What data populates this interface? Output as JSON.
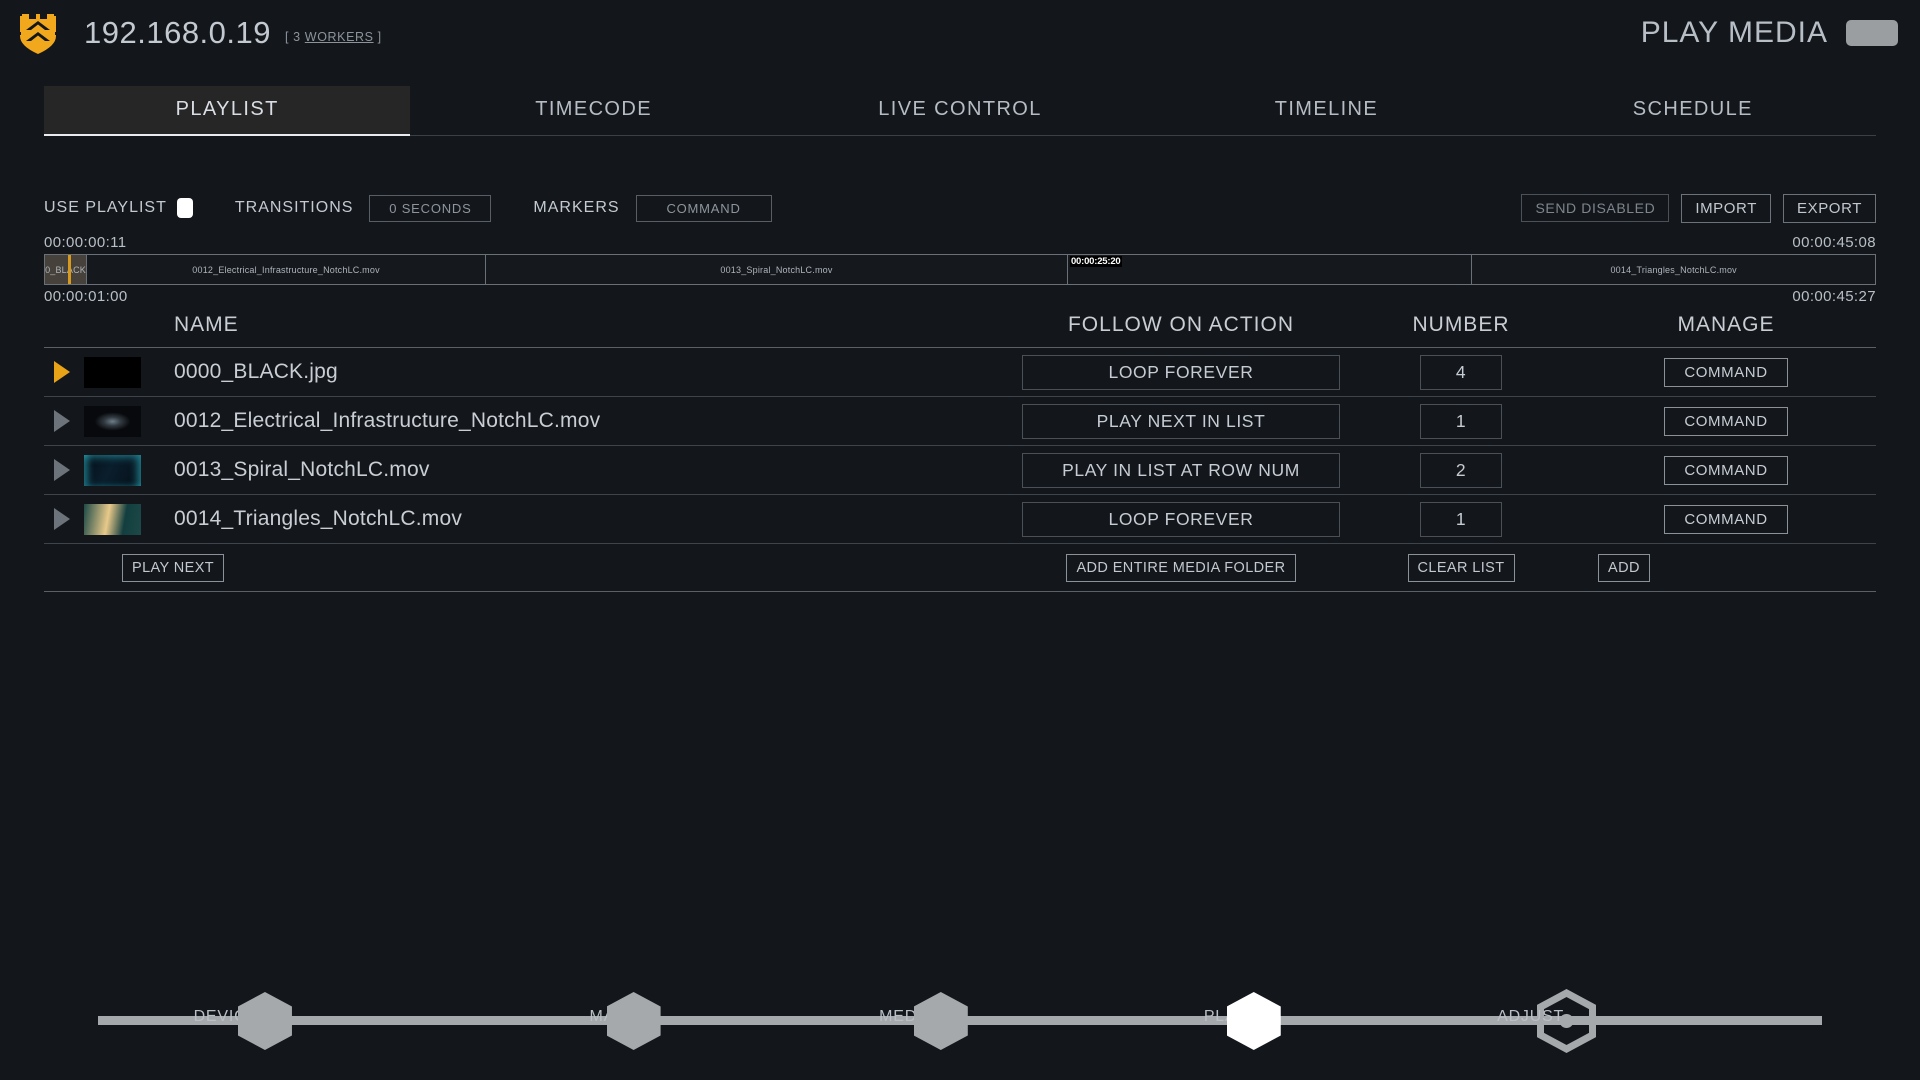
{
  "header": {
    "logo_icon": "shield-chevron-logo-icon",
    "host": "192.168.0.19",
    "workers_prefix": "[ 3 ",
    "workers_link": "WORKERS",
    "workers_suffix": " ]",
    "mode_title": "PLAY MEDIA",
    "accent_color": "#f2a81d"
  },
  "tabs": [
    {
      "label": "PLAYLIST",
      "active": true
    },
    {
      "label": "TIMECODE",
      "active": false
    },
    {
      "label": "LIVE CONTROL",
      "active": false
    },
    {
      "label": "TIMELINE",
      "active": false
    },
    {
      "label": "SCHEDULE",
      "active": false
    }
  ],
  "toolbar": {
    "use_playlist_label": "USE PLAYLIST",
    "use_playlist_on": true,
    "transitions_label": "TRANSITIONS",
    "transitions_value": "0 SECONDS",
    "markers_label": "MARKERS",
    "markers_value": "COMMAND",
    "send_disabled_label": "SEND DISABLED",
    "import_label": "IMPORT",
    "export_label": "EXPORT"
  },
  "timeline": {
    "top_left_time": "00:00:00:11",
    "top_right_time": "00:00:45:08",
    "bottom_left_time": "00:00:01:00",
    "bottom_right_time": "00:00:45:27",
    "cursor_time": "00:00:25:20",
    "segments": [
      {
        "label": "0_BLACK",
        "width_pct": 2.3,
        "current": true,
        "playhead_pct": 55
      },
      {
        "label": "0012_Electrical_Infrastructure_NotchLC.mov",
        "width_pct": 21.8,
        "current": false
      },
      {
        "label": "0013_Spiral_NotchLC.mov",
        "width_pct": 31.8,
        "current": false
      },
      {
        "label": "",
        "width_pct": 22.1,
        "current": false
      },
      {
        "label": "0014_Triangles_NotchLC.mov",
        "width_pct": 22.0,
        "current": false
      }
    ]
  },
  "table": {
    "columns": {
      "name": "NAME",
      "action": "FOLLOW ON ACTION",
      "number": "NUMBER",
      "manage": "MANAGE"
    },
    "rows": [
      {
        "playing": true,
        "name": "0000_BLACK.jpg",
        "action": "LOOP FOREVER",
        "number": "4",
        "manage": "COMMAND",
        "thumb": "black-thumbnail",
        "thumb_colors": [
          "#000000",
          "#050505"
        ]
      },
      {
        "playing": false,
        "name": "0012_Electrical_Infrastructure_NotchLC.mov",
        "action": "PLAY NEXT IN LIST",
        "number": "1",
        "manage": "COMMAND",
        "thumb": "electrical-infrastructure-thumbnail",
        "thumb_colors": [
          "#07090c",
          "#6d7e88"
        ]
      },
      {
        "playing": false,
        "name": "0013_Spiral_NotchLC.mov",
        "action": "PLAY IN LIST AT ROW NUM",
        "number": "2",
        "manage": "COMMAND",
        "thumb": "spiral-thumbnail",
        "thumb_colors": [
          "#061018",
          "#36d3e8"
        ]
      },
      {
        "playing": false,
        "name": "0014_Triangles_NotchLC.mov",
        "action": "LOOP FOREVER",
        "number": "1",
        "manage": "COMMAND",
        "thumb": "triangles-thumbnail",
        "thumb_colors": [
          "#1d4a48",
          "#e8c98a"
        ]
      }
    ],
    "footer": {
      "play_next": "PLAY NEXT",
      "add_entire_media_folder": "ADD ENTIRE MEDIA FOLDER",
      "clear_list": "CLEAR LIST",
      "add": "ADD"
    }
  },
  "bottom_nav": {
    "steps": [
      {
        "label": "DEVICE",
        "pos_pct": 13.8,
        "active": false,
        "ring": false
      },
      {
        "label": "MAP",
        "pos_pct": 33.0,
        "active": false,
        "ring": false
      },
      {
        "label": "MEDIA",
        "pos_pct": 49.0,
        "active": false,
        "ring": false
      },
      {
        "label": "PLAY",
        "pos_pct": 65.3,
        "active": true,
        "ring": false
      },
      {
        "label": "ADJUST",
        "pos_pct": 81.7,
        "active": false,
        "ring": true
      }
    ]
  }
}
